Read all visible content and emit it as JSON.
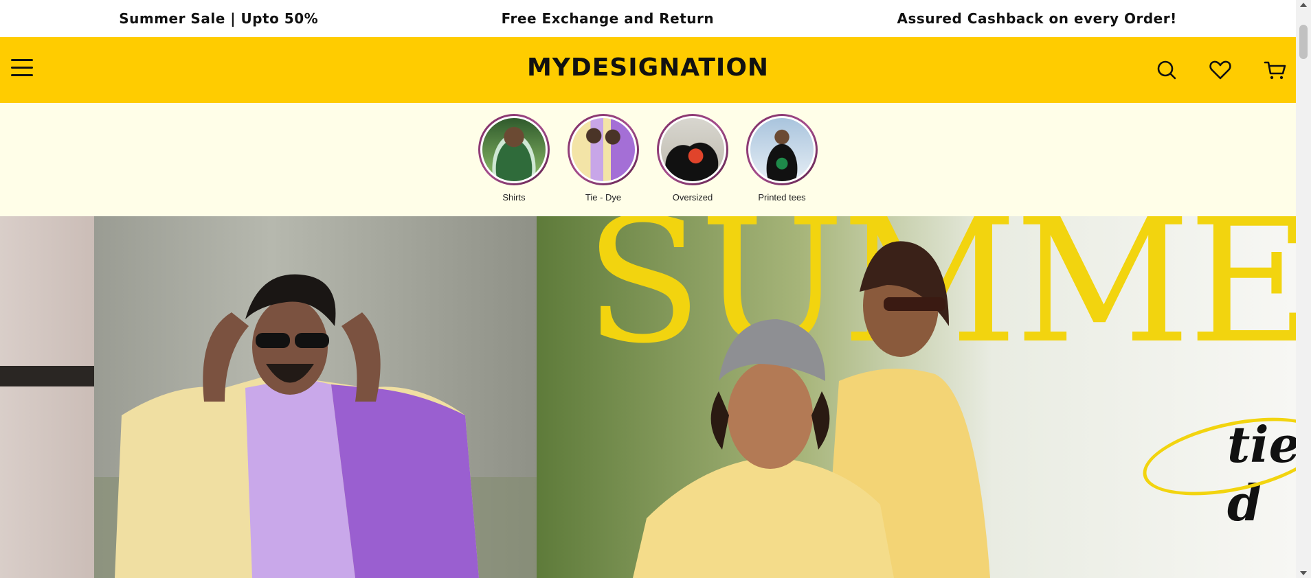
{
  "announcements": [
    "Summer Sale | Upto 50%",
    "Free Exchange and Return",
    "Assured Cashback on every Order!"
  ],
  "header": {
    "brand": "MYDESIGNATION",
    "accent": "#ffcc00"
  },
  "icons": {
    "menu": "hamburger-icon",
    "search": "search-icon",
    "wishlist": "heart-icon",
    "cart": "cart-icon"
  },
  "categories": [
    {
      "label": "Shirts"
    },
    {
      "label": "Tie - Dye"
    },
    {
      "label": "Oversized"
    },
    {
      "label": "Printed tees"
    }
  ],
  "hero": {
    "headline": "SUMME",
    "script": "tie d"
  }
}
